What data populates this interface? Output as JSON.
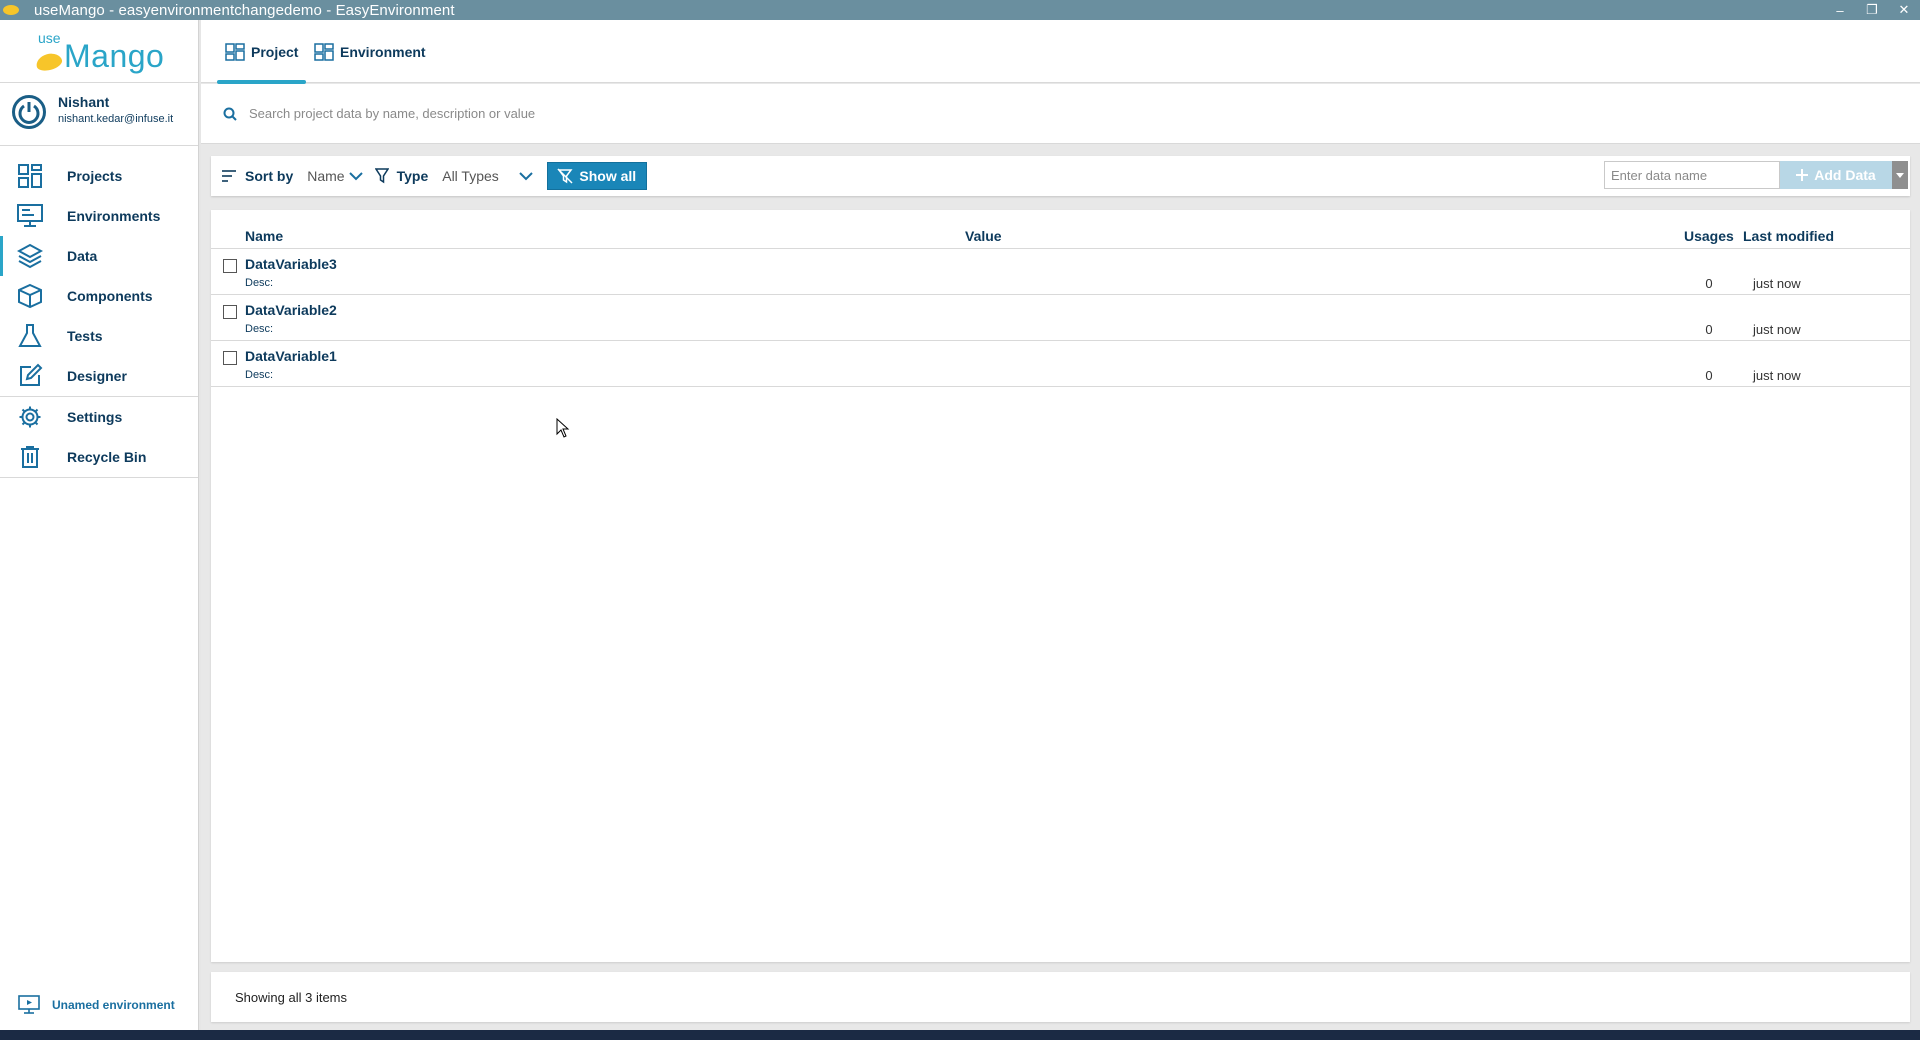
{
  "window": {
    "title": "useMango - easyenvironmentchangedemo - EasyEnvironment",
    "controls": {
      "minimize": "–",
      "restore": "❐",
      "close": "✕"
    }
  },
  "logo": {
    "use": "use",
    "mango": "Mango"
  },
  "user": {
    "name": "Nishant",
    "email": "nishant.kedar@infuse.it"
  },
  "sidebar": {
    "items": [
      {
        "label": "Projects",
        "icon": "projects-icon"
      },
      {
        "label": "Environments",
        "icon": "environments-icon"
      },
      {
        "label": "Data",
        "icon": "data-layers-icon"
      },
      {
        "label": "Components",
        "icon": "components-cube-icon"
      },
      {
        "label": "Tests",
        "icon": "tests-flask-icon"
      },
      {
        "label": "Designer",
        "icon": "designer-pencil-icon"
      }
    ],
    "secondary_items": [
      {
        "label": "Settings",
        "icon": "gear-icon"
      },
      {
        "label": "Recycle Bin",
        "icon": "trash-icon"
      }
    ],
    "active": "Data",
    "environment_footer": "Unamed environment"
  },
  "tabs": [
    {
      "label": "Project",
      "active": true
    },
    {
      "label": "Environment",
      "active": false
    }
  ],
  "search": {
    "placeholder": "Search project data by name, description or value"
  },
  "toolbar": {
    "sort_by_label": "Sort by",
    "sort_by_value": "Name",
    "type_label": "Type",
    "type_value": "All Types",
    "show_all_label": "Show all",
    "data_name_placeholder": "Enter data name",
    "add_data_label": "Add Data"
  },
  "table": {
    "columns": {
      "name": "Name",
      "value": "Value",
      "usages": "Usages",
      "last_modified": "Last modified"
    },
    "rows": [
      {
        "name": "DataVariable3",
        "desc": "Desc:",
        "value": "",
        "usages": "0",
        "last_modified": "just now"
      },
      {
        "name": "DataVariable2",
        "desc": "Desc:",
        "value": "",
        "usages": "0",
        "last_modified": "just now"
      },
      {
        "name": "DataVariable1",
        "desc": "Desc:",
        "value": "",
        "usages": "0",
        "last_modified": "just now"
      }
    ]
  },
  "status": {
    "text": "Showing all 3 items"
  },
  "colors": {
    "accent": "#2aa5c8",
    "primary_text": "#0d3a5c",
    "show_all_button": "#1a86b8",
    "titlebar": "#6a8f9f"
  }
}
